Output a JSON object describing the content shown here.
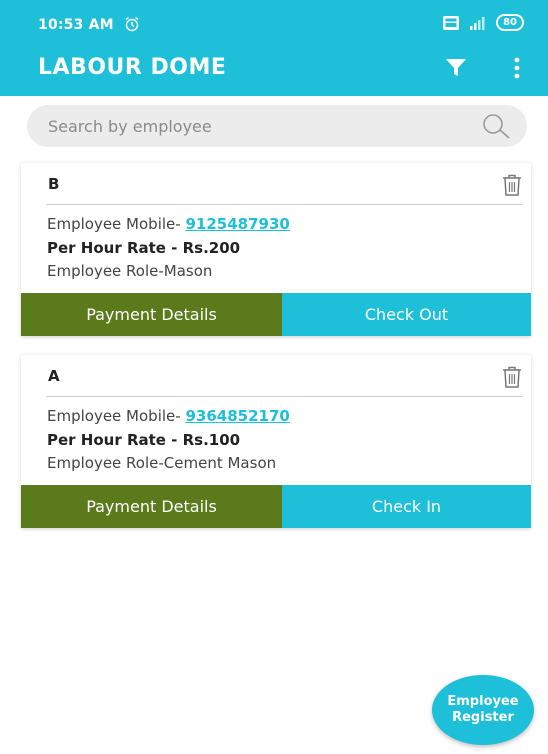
{
  "status_bar": {
    "time": "10:53 AM",
    "battery": "80"
  },
  "header": {
    "title": "LABOUR DOME"
  },
  "search": {
    "placeholder": "Search by employee"
  },
  "employees": [
    {
      "name": "B",
      "mobile_label": "Employee Mobile- ",
      "mobile": "9125487930",
      "rate": "Per Hour Rate - Rs.200",
      "role": "Employee Role-Mason",
      "payment_label": "Payment Details",
      "action_label": "Check Out"
    },
    {
      "name": "A",
      "mobile_label": "Employee Mobile- ",
      "mobile": "9364852170",
      "rate": "Per Hour Rate - Rs.100",
      "role": "Employee Role-Cement Mason",
      "payment_label": "Payment Details",
      "action_label": "Check In"
    }
  ],
  "fab": {
    "line1": "Employee",
    "line2": "Register"
  },
  "colors": {
    "primary": "#1ebfd8",
    "payment_button": "#5a7a1c"
  }
}
